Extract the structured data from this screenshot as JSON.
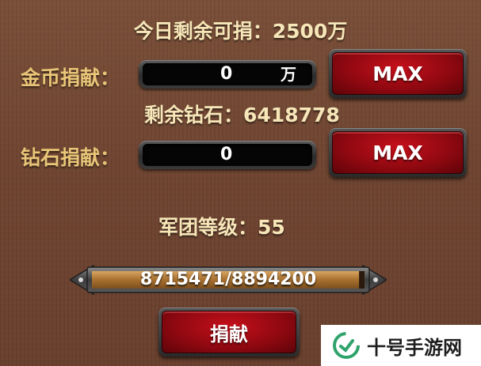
{
  "donation": {
    "remaining_label": "今日剩余可捐：",
    "remaining_value": "2500万",
    "gold_label": "金币捐献：",
    "gold_value": "0",
    "gold_unit": "万",
    "gems_label": "剩余钻石：",
    "gems_value": "6418778",
    "gem_label": "钻石捐献：",
    "gem_value": "0",
    "max_label": "MAX",
    "level_label": "军团等级：",
    "level_value": "55",
    "progress_current": 8715471,
    "progress_total": 8894200,
    "progress_text": "8715471/8894200",
    "donate_label": "捐献"
  },
  "watermark": {
    "text": "十号手游网",
    "logo_icon": "shiyao-logo-icon"
  },
  "colors": {
    "background": "#6f4431",
    "label_gold": "#e8c577",
    "text_cream": "#f6e6b8",
    "button_red": "#a50a14",
    "progress_fill": "#b07a3d"
  }
}
